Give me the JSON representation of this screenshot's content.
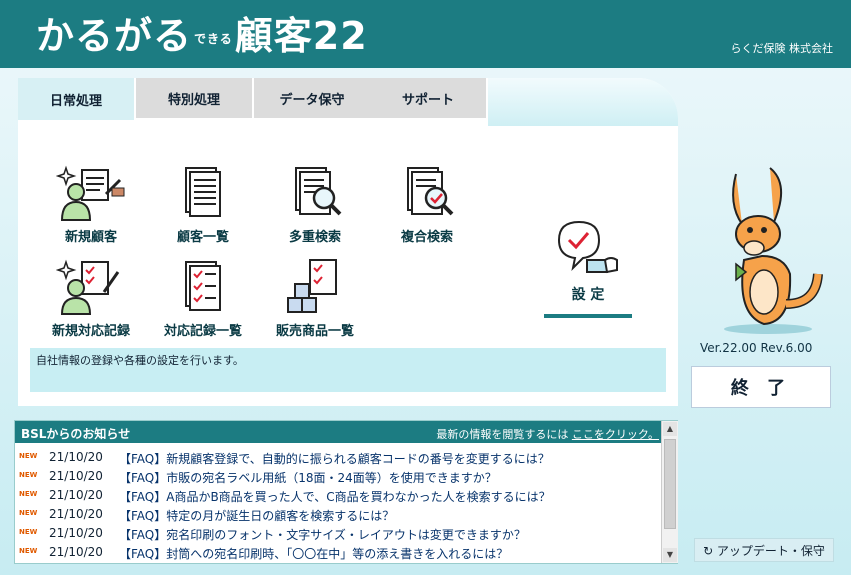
{
  "app": {
    "logo_main": "かるがる",
    "logo_small": "できる",
    "logo_product": "顧客22",
    "company": "らくだ保険 株式会社"
  },
  "tabs": [
    {
      "label": "日常処理",
      "active": true
    },
    {
      "label": "特別処理",
      "active": false
    },
    {
      "label": "データ保守",
      "active": false
    },
    {
      "label": "サポート",
      "active": false
    }
  ],
  "menu": [
    {
      "label": "新規顧客",
      "icon": "new-customer-icon"
    },
    {
      "label": "顧客一覧",
      "icon": "customer-list-icon"
    },
    {
      "label": "多重検索",
      "icon": "multi-search-icon"
    },
    {
      "label": "複合検索",
      "icon": "compound-search-icon"
    },
    {
      "label": "新規対応記録",
      "icon": "new-record-icon"
    },
    {
      "label": "対応記録一覧",
      "icon": "record-list-icon"
    },
    {
      "label": "販売商品一覧",
      "icon": "products-icon"
    }
  ],
  "settings": {
    "label": "設 定",
    "icon": "settings-check-icon"
  },
  "description": "自社情報の登録や各種の設定を行います。",
  "version": "Ver.22.00 Rev.6.00",
  "exit_label": "終 了",
  "update_label": "↻ アップデート・保守",
  "news": {
    "title": "BSLからのお知らせ",
    "info_prefix": "最新の情報を閲覧するには",
    "info_link": "ここをクリック。",
    "badge": "NEW",
    "items": [
      {
        "date": "21/10/20",
        "text": "【FAQ】新規顧客登録で、自動的に振られる顧客コードの番号を変更するには？"
      },
      {
        "date": "21/10/20",
        "text": "【FAQ】市販の宛名ラベル用紙（18面・24面等）を使用できますか？"
      },
      {
        "date": "21/10/20",
        "text": "【FAQ】A商品かB商品を買った人で、C商品を買わなかった人を検索するには？"
      },
      {
        "date": "21/10/20",
        "text": "【FAQ】特定の月が誕生日の顧客を検索するには？"
      },
      {
        "date": "21/10/20",
        "text": "【FAQ】宛名印刷のフォント・文字サイズ・レイアウトは変更できますか？"
      },
      {
        "date": "21/10/20",
        "text": "【FAQ】封筒への宛名印刷時、「〇〇在中」等の添え書きを入れるには？"
      }
    ]
  },
  "colors": {
    "header": "#1c7c82",
    "panel_bg": "#ffffff",
    "desc_bg": "#c8eef3",
    "badge": "#e05a00"
  }
}
